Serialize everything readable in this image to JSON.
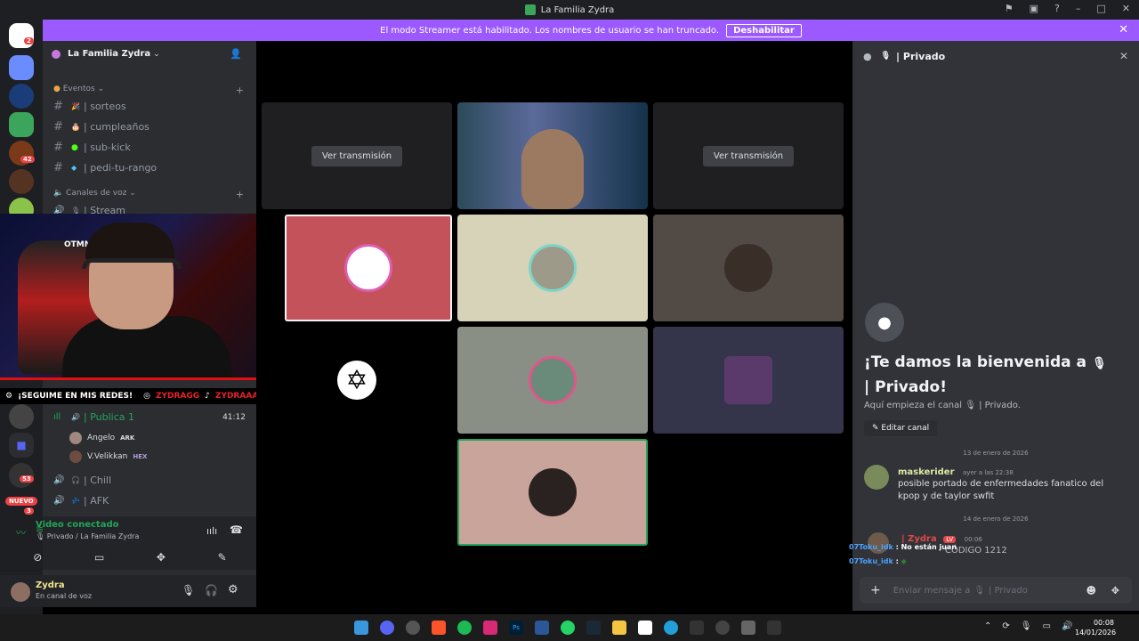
{
  "window": {
    "title": "La Familia Zydra",
    "icon_colors": {
      "accent": "#5865f2",
      "banner": "#9b59ff"
    }
  },
  "banner": {
    "text": "El modo Streamer está habilitado. Los nombres de usuario se han truncado.",
    "button": "Deshabilitar"
  },
  "rail": {
    "badges": [
      "2",
      "42",
      "53",
      "3"
    ],
    "new_label": "NUEVO"
  },
  "sidebar": {
    "server_name": "La Familia Zydra",
    "events_category": "Eventos",
    "text_channels": [
      "| sorteos",
      "| cumpleaños",
      "| sub-kick",
      "| pedi-tu-rango"
    ],
    "voice_category": "Canales de voz",
    "voice_channels": [
      "| Stream",
      "| Publica 1",
      "| Chill",
      "| AFK"
    ],
    "publica_time": "41:12",
    "voice_users": [
      {
        "name": "Angelo",
        "tag": "ARK"
      },
      {
        "name": "V.Velikkan",
        "tag": "HEX"
      }
    ]
  },
  "overlay": {
    "socials_text": "¡SEGUIME EN MIS REDES!",
    "instagram": "ZYDRAGG",
    "tiktok": "ZYDRAAAA_",
    "webcam_logo": "OTMM"
  },
  "voice_panel": {
    "status": "Video conectado",
    "channel": "Privado / La Familia Zydra"
  },
  "user_panel": {
    "username": "Zydra",
    "status": "En canal de voz"
  },
  "stage": {
    "watch_stream": "Ver transmisión"
  },
  "right_panel": {
    "channel_title": "| Privado",
    "welcome_title_1": "¡Te damos la bienvenida a",
    "welcome_title_2": "| Privado!",
    "welcome_sub_prefix": "Aquí empieza el canal",
    "welcome_sub_suffix": "| Privado.",
    "edit_channel": "Editar canal",
    "date1": "13 de enero de 2026",
    "date2": "14 de enero de 2026",
    "messages": [
      {
        "author": "maskerider",
        "time": "ayer a las 22:38",
        "text": "posible portado de enfermedades fanatico del kpop y de taylor swfit"
      },
      {
        "author": "| Zydra",
        "badge": "LV",
        "time": "00:06",
        "text": "CÓDIGO 1212"
      }
    ],
    "chat_overlay": [
      {
        "user": "07Toku_idk",
        "text": "No están juan"
      },
      {
        "user": "07Toku_idk",
        "text": ""
      }
    ],
    "input_prefix": "Enviar mensaje a",
    "input_channel": "| Privado"
  },
  "taskbar": {
    "time": "00:08",
    "date": "14/01/2026"
  }
}
